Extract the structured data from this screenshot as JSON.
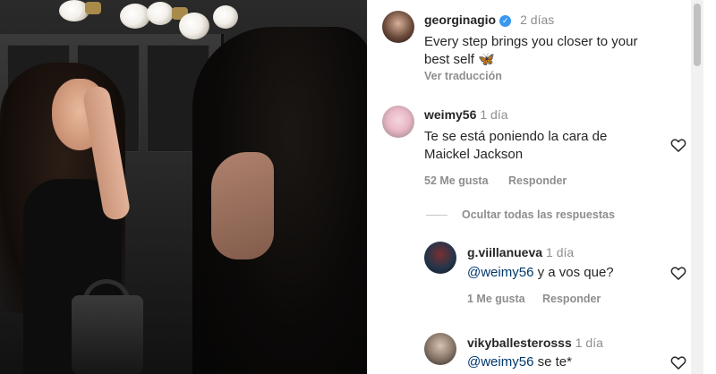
{
  "post": {
    "author": "georginagio",
    "time": "2 días",
    "caption": "Every step brings you closer to your",
    "caption_line2": "best self 🦋",
    "translate": "Ver traducción"
  },
  "comments": [
    {
      "author": "weimy56",
      "time": "1 día",
      "text_line1": "Te se está poniendo la cara de",
      "text_line2": "Maickel Jackson",
      "likes": "52 Me gusta",
      "reply": "Responder"
    }
  ],
  "replies_toggle": "Ocultar todas las respuestas",
  "replies": [
    {
      "author": "g.viillanueva",
      "time": "1 día",
      "mention": "@weimy56",
      "text": " y a vos que?",
      "likes": "1 Me gusta",
      "reply": "Responder"
    },
    {
      "author": "vikyballesterosss",
      "time": "1 día",
      "mention": "@weimy56",
      "text": " se te*"
    }
  ],
  "icons": {
    "like": "heart-outline-icon",
    "verified": "verified-badge-icon"
  },
  "colors": {
    "text": "#262626",
    "muted": "#8e8e8e",
    "mention": "#00376b",
    "verified": "#3897f0"
  }
}
